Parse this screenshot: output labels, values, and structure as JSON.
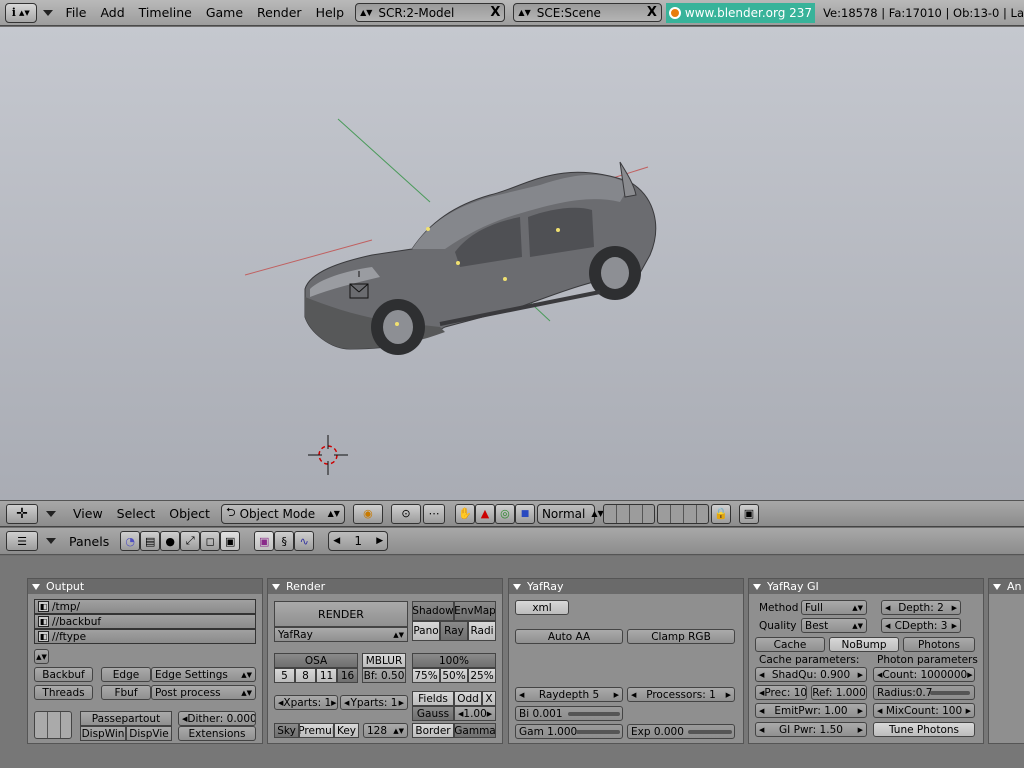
{
  "top_header": {
    "info_icon": "i",
    "menus": [
      "File",
      "Add",
      "Timeline",
      "Game",
      "Render",
      "Help"
    ],
    "screen_field": "SCR:2-Model",
    "scene_field": "SCE:Scene",
    "url": "www.blender.org 237",
    "stats": "Ve:18578 | Fa:17010 | Ob:13-0 | La"
  },
  "viewport_header": {
    "menus": [
      "View",
      "Select",
      "Object"
    ],
    "mode": "Object Mode",
    "draw_type": "Normal"
  },
  "buttons_header": {
    "panels_label": "Panels",
    "frame": "1"
  },
  "output_panel": {
    "title": "Output",
    "paths": [
      "/tmp/",
      "//backbuf",
      "//ftype"
    ],
    "backbuf": "Backbuf",
    "edge": "Edge",
    "edge_settings": "Edge Settings",
    "threads": "Threads",
    "fbuf": "Fbuf",
    "post_process": "Post process",
    "passepartout": "Passepartout",
    "dither": "Dither: 0.000",
    "dispwin": "DispWin",
    "dispview": "DispVie",
    "extensions": "Extensions"
  },
  "render_panel": {
    "title": "Render",
    "render_button": "RENDER",
    "renderer": "YafRay",
    "shadow": "Shadow",
    "envmap": "EnvMap",
    "pano": "Pano",
    "ray": "Ray",
    "radio": "Radi",
    "osa": "OSA",
    "mblur": "MBLUR",
    "percent_100": "100%",
    "osa_levels": [
      "5",
      "8",
      "11",
      "16"
    ],
    "bf": "Bf: 0.50",
    "percents": [
      "75%",
      "50%",
      "25%"
    ],
    "xparts": "Xparts: 1",
    "yparts": "Yparts: 1",
    "fields": "Fields",
    "odd": "Odd",
    "x": "X",
    "gauss": "Gauss",
    "gauss_value": "1.00",
    "sky": "Sky",
    "premul": "Premul",
    "key": "Key",
    "depth": "128",
    "border": "Border",
    "gamma": "Gamma"
  },
  "yafray_panel": {
    "title": "YafRay",
    "xml": "xml",
    "auto_aa": "Auto AA",
    "clamp_rgb": "Clamp RGB",
    "raydepth": "Raydepth 5",
    "processors": "Processors: 1",
    "bi": "Bi 0.001",
    "gam": "Gam 1.000",
    "exp": "Exp 0.000"
  },
  "yafray_gi_panel": {
    "title": "YafRay GI",
    "method_label": "Method",
    "method": "Full",
    "depth": "Depth: 2",
    "quality_label": "Quality",
    "quality": "Best",
    "cdepth": "CDepth: 3",
    "cache": "Cache",
    "nobump": "NoBump",
    "photons": "Photons",
    "cache_params": "Cache parameters:",
    "photon_params": "Photon parameters",
    "shadqu": "ShadQu: 0.900",
    "count": "Count: 1000000",
    "prec": "Prec: 10",
    "ref": "Ref: 1.000",
    "radius": "Radius:0.7",
    "emitpwr": "EmitPwr: 1.00",
    "mixcount": "MixCount: 100",
    "gipwr": "GI Pwr: 1.50",
    "tune_photons": "Tune Photons"
  },
  "anim_panel": {
    "title": "An"
  }
}
